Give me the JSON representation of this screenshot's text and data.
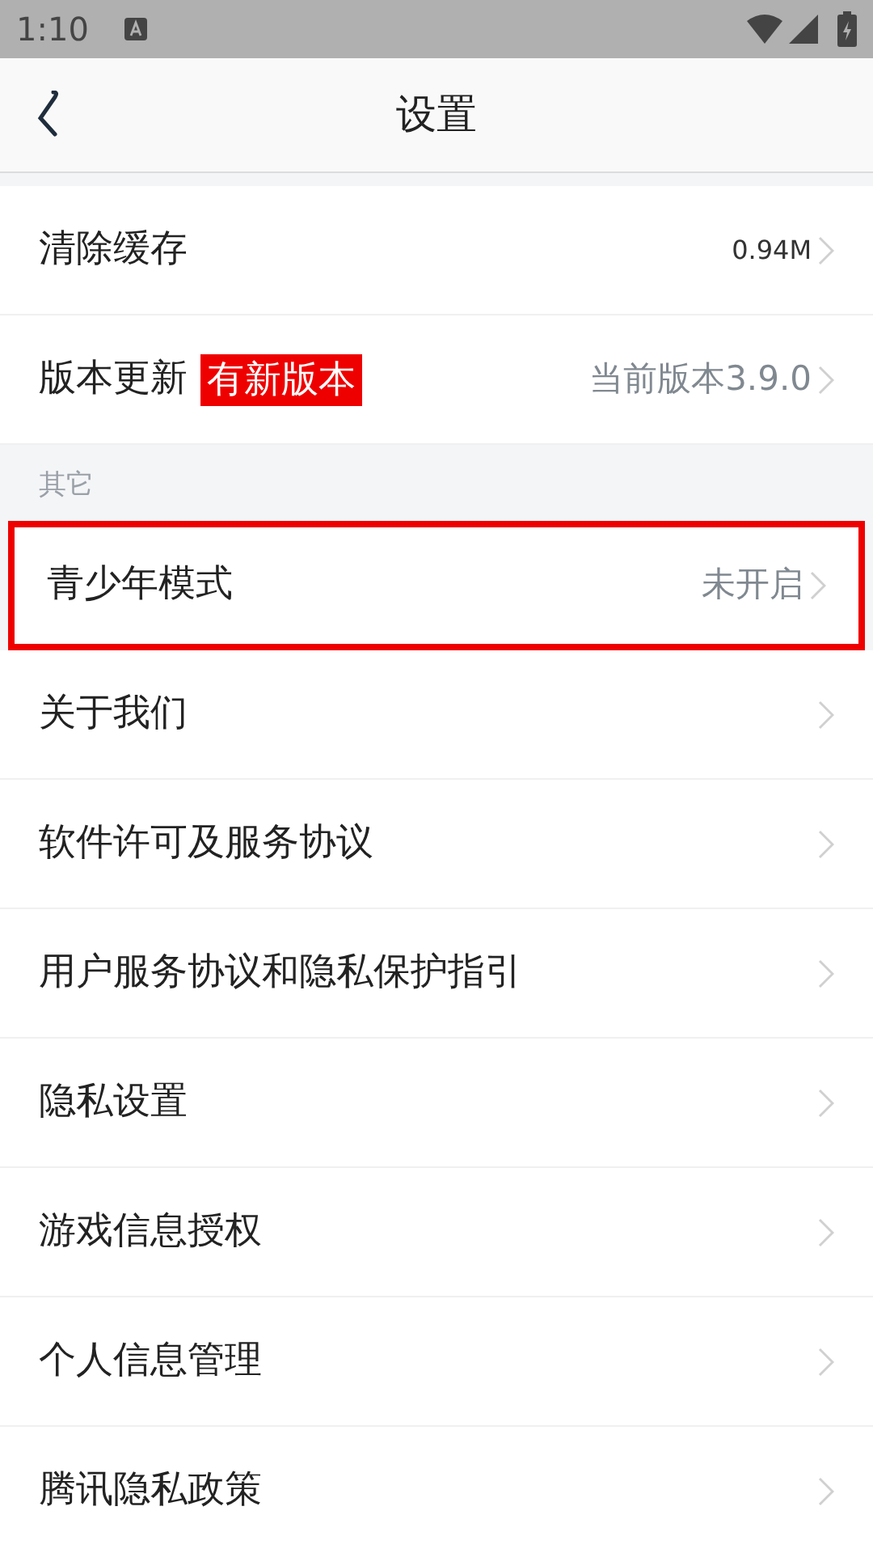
{
  "status_bar": {
    "time": "1:10"
  },
  "header": {
    "title": "设置"
  },
  "groups": [
    {
      "rows": [
        {
          "kind": "compact",
          "label": "清除缓存",
          "value": "0.94M",
          "highlighted": false
        },
        {
          "kind": "standard",
          "label": "版本更新",
          "badge": "有新版本",
          "value": "当前版本3.9.0",
          "highlighted": false
        }
      ]
    },
    {
      "title": "其它",
      "rows": [
        {
          "kind": "standard",
          "label": "青少年模式",
          "value": "未开启",
          "highlighted": true
        },
        {
          "kind": "standard",
          "label": "关于我们",
          "highlighted": false
        },
        {
          "kind": "standard",
          "label": "软件许可及服务协议",
          "highlighted": false
        },
        {
          "kind": "standard",
          "label": "用户服务协议和隐私保护指引",
          "highlighted": false
        },
        {
          "kind": "standard",
          "label": "隐私设置",
          "highlighted": false
        },
        {
          "kind": "standard",
          "label": "游戏信息授权",
          "highlighted": false
        },
        {
          "kind": "standard",
          "label": "个人信息管理",
          "highlighted": false
        },
        {
          "kind": "standard",
          "label": "腾讯隐私政策",
          "highlighted": false
        }
      ]
    }
  ]
}
